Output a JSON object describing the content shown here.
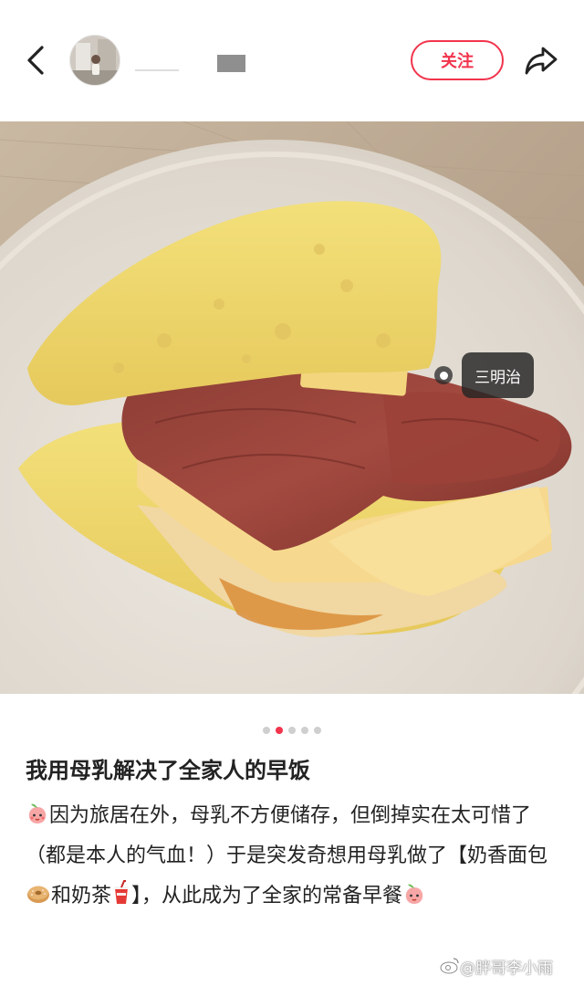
{
  "header": {
    "follow_label": "关注"
  },
  "photo": {
    "tag_label": "三明治"
  },
  "pagination": {
    "total": 5,
    "active_index": 1
  },
  "post": {
    "title": "我用母乳解决了全家人的早饭",
    "body_part1": "因为旅居在外，母乳不方便储存，但倒掉实在太可惜了（都是本人的气血！）于是突发奇想用母乳做了【奶香面包",
    "body_part2": "和奶茶",
    "body_part3": "】，从此成为了全家的常备早餐"
  },
  "watermark": "@胖哥李小雨",
  "colors": {
    "accent": "#f2344d"
  },
  "icons": {
    "back": "chevron-left-icon",
    "share": "share-arrow-icon",
    "emoji_peach": "peach-face-emoji",
    "emoji_bagel": "bagel-emoji",
    "emoji_drink": "cup-with-straw-emoji"
  }
}
